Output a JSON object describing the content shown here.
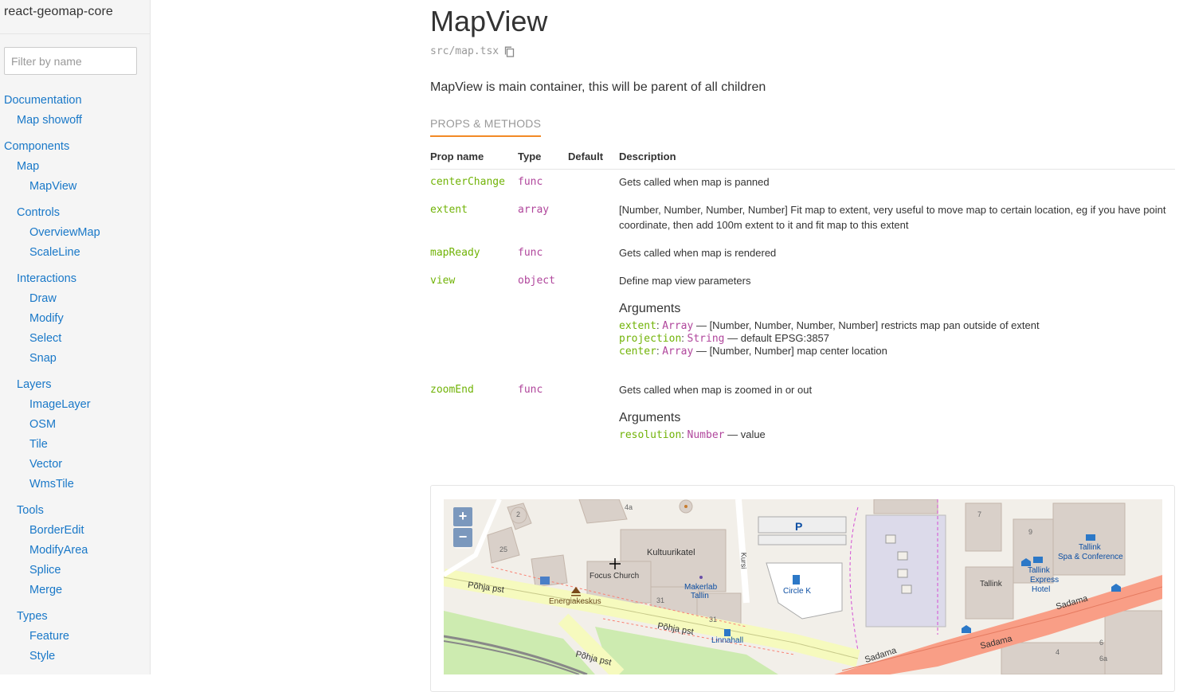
{
  "sidebar": {
    "brand": "react-geomap-core",
    "filter_placeholder": "Filter by name",
    "items": [
      {
        "label": "Documentation",
        "level": 0
      },
      {
        "label": "Map showoff",
        "level": 1
      },
      {
        "label": "Components",
        "level": 0
      },
      {
        "label": "Map",
        "level": 1
      },
      {
        "label": "MapView",
        "level": 2
      },
      {
        "label": "Controls",
        "level": 1
      },
      {
        "label": "OverviewMap",
        "level": 2
      },
      {
        "label": "ScaleLine",
        "level": 2
      },
      {
        "label": "Interactions",
        "level": 1
      },
      {
        "label": "Draw",
        "level": 2
      },
      {
        "label": "Modify",
        "level": 2
      },
      {
        "label": "Select",
        "level": 2
      },
      {
        "label": "Snap",
        "level": 2
      },
      {
        "label": "Layers",
        "level": 1
      },
      {
        "label": "ImageLayer",
        "level": 2
      },
      {
        "label": "OSM",
        "level": 2
      },
      {
        "label": "Tile",
        "level": 2
      },
      {
        "label": "Vector",
        "level": 2
      },
      {
        "label": "WmsTile",
        "level": 2
      },
      {
        "label": "Tools",
        "level": 1
      },
      {
        "label": "BorderEdit",
        "level": 2
      },
      {
        "label": "ModifyArea",
        "level": 2
      },
      {
        "label": "Splice",
        "level": 2
      },
      {
        "label": "Merge",
        "level": 2
      },
      {
        "label": "Types",
        "level": 1
      },
      {
        "label": "Feature",
        "level": 2
      },
      {
        "label": "Style",
        "level": 2
      }
    ]
  },
  "main": {
    "title": "MapView",
    "path": "src/map.tsx",
    "description": "MapView is main container, this will be parent of all children",
    "tab": "PROPS & METHODS",
    "columns": {
      "name": "Prop name",
      "type": "Type",
      "default": "Default",
      "description": "Description"
    },
    "props": [
      {
        "name": "centerChange",
        "type": "func",
        "description": "Gets called when map is panned"
      },
      {
        "name": "extent",
        "type": "array",
        "description": "[Number, Number, Number, Number] Fit map to extent, very useful to move map to certain location, eg if you have point coordinate, then add 100m extent to it and fit map to this extent"
      },
      {
        "name": "mapReady",
        "type": "func",
        "description": "Gets called when map is rendered"
      },
      {
        "name": "view",
        "type": "object",
        "description": "Define map view parameters",
        "arguments_title": "Arguments",
        "arguments": [
          {
            "name": "extent",
            "type": "Array",
            "text": " — [Number, Number, Number, Number] restricts map pan outside of extent"
          },
          {
            "name": "projection",
            "type": "String",
            "text": " — default EPSG:3857"
          },
          {
            "name": "center",
            "type": "Array",
            "text": " — [Number, Number] map center location"
          }
        ]
      },
      {
        "name": "zoomEnd",
        "type": "func",
        "description": "Gets called when map is zoomed in or out",
        "arguments_title": "Arguments",
        "arguments": [
          {
            "name": "resolution",
            "type": "Number",
            "text": " — value"
          }
        ]
      }
    ]
  },
  "map": {
    "zoom_in": "+",
    "zoom_out": "−",
    "labels": {
      "kultuurikatel": "Kultuurikatel",
      "focus_church": "Focus Church",
      "makerlab": "Makerlab",
      "tallin": "Tallin",
      "energiakeskus": "Energiakeskus",
      "pohja1": "Põhja pst",
      "pohja2": "Põhja pst",
      "pohja3": "Põhja pst",
      "linnahall": "Linnahall",
      "kursi": "Kursi",
      "circle_k": "Circle K",
      "parking": "P",
      "tallink": "Tallink",
      "tallink_express": "Tallink",
      "express": "Express",
      "hotel": "Hotel",
      "tallink_spa": "Tallink",
      "spa_conf": "Spa & Conference",
      "sadama1": "Sadama",
      "sadama2": "Sadama",
      "sadama3": "Sadama",
      "n2": "2",
      "n4a": "4a",
      "n25": "25",
      "n31a": "31",
      "n31b": "31",
      "n7": "7",
      "n9": "9",
      "n6": "6",
      "n4": "4",
      "n6a": "6a"
    }
  },
  "colors": {
    "link": "#1978c8",
    "prop_name": "#71b307",
    "prop_type": "#b0469c",
    "tab_underline": "#f28a25",
    "road_primary": "#f99e86",
    "road_secondary": "#f6fabe",
    "park": "#cdebb0"
  }
}
